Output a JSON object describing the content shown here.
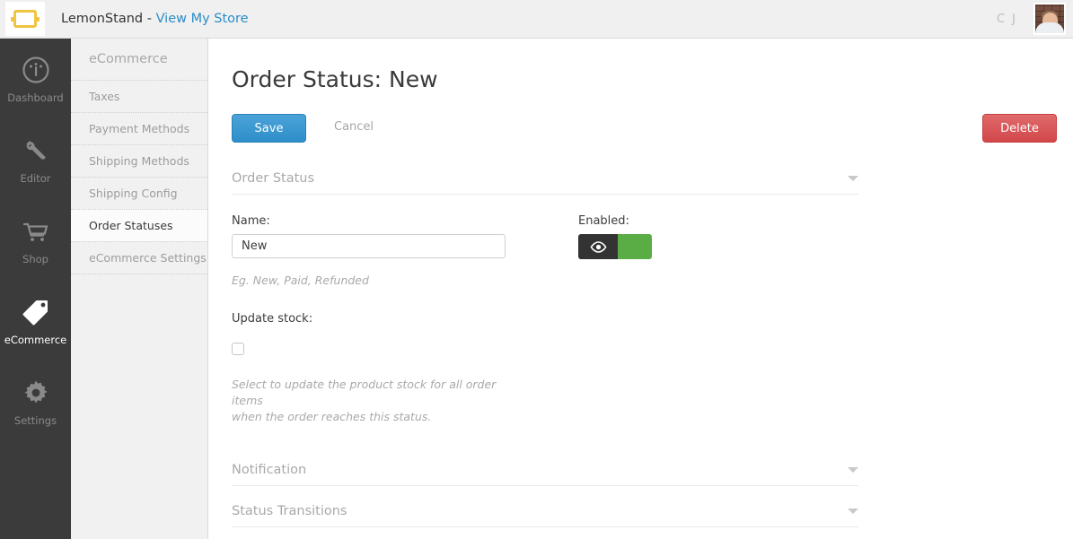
{
  "header": {
    "logo_icon": "lemonstand-logo-icon",
    "brand_prefix": "LemonStand - ",
    "store_link": "View My Store",
    "user_initials": "C J",
    "avatar_icon": "user-avatar"
  },
  "rail": {
    "items": [
      {
        "label": "Dashboard",
        "icon": "dashboard-icon",
        "active": false
      },
      {
        "label": "Editor",
        "icon": "editor-tools-icon",
        "active": false
      },
      {
        "label": "Shop",
        "icon": "shopping-cart-icon",
        "active": false
      },
      {
        "label": "eCommerce",
        "icon": "tag-icon",
        "active": true
      },
      {
        "label": "Settings",
        "icon": "gear-icon",
        "active": false
      }
    ]
  },
  "subnav": {
    "title": "eCommerce",
    "items": [
      {
        "label": "Taxes",
        "active": false
      },
      {
        "label": "Payment Methods",
        "active": false
      },
      {
        "label": "Shipping Methods",
        "active": false
      },
      {
        "label": "Shipping Config",
        "active": false
      },
      {
        "label": "Order Statuses",
        "active": true
      },
      {
        "label": "eCommerce Settings",
        "active": false
      }
    ]
  },
  "main": {
    "page_title": "Order Status: New",
    "toolbar": {
      "save_label": "Save",
      "cancel_label": "Cancel",
      "delete_label": "Delete"
    },
    "sections": {
      "order_status": "Order Status",
      "notification": "Notification",
      "status_transitions": "Status Transitions"
    },
    "fields": {
      "name_label": "Name:",
      "name_value": "New",
      "name_placeholder": "",
      "name_hint": "Eg. New, Paid, Refunded",
      "enabled_label": "Enabled:",
      "enabled_icon": "eye-icon",
      "enabled_state": "on",
      "update_stock_label": "Update stock:",
      "update_stock_checked": false,
      "update_stock_hint_line1": "Select to update the product stock for all order items",
      "update_stock_hint_line2": "when the order reaches this status."
    }
  },
  "colors": {
    "accent_blue": "#2e8ec9",
    "danger_red": "#d1474a",
    "toggle_green": "#5aad45",
    "rail_dark": "#3b3b3b",
    "logo_yellow": "#f0c341"
  }
}
